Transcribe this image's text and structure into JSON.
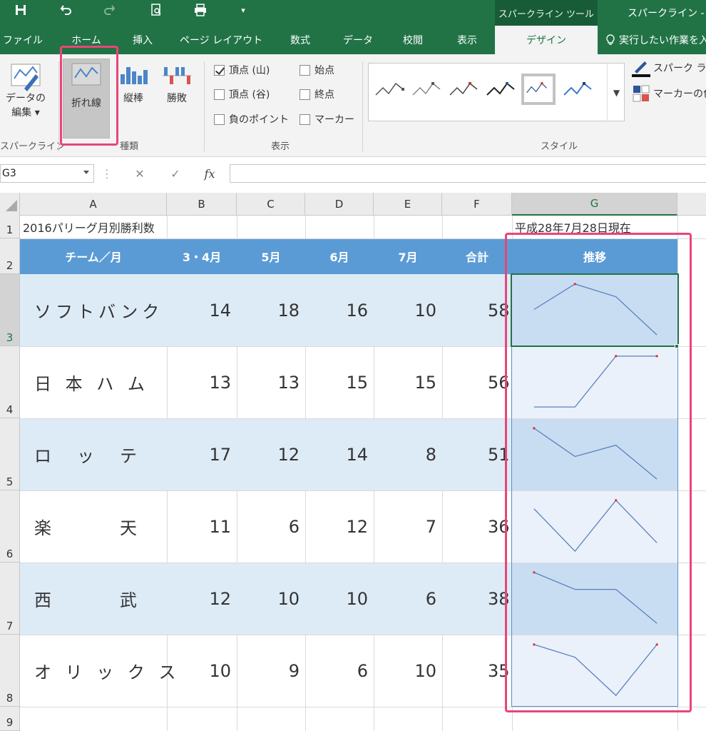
{
  "titlebar": {
    "context_tool": "スパークライン ツール",
    "window_title": "スパークライン -"
  },
  "tabs": [
    "ファイル",
    "ホーム",
    "挿入",
    "ページ レイアウト",
    "数式",
    "データ",
    "校閲",
    "表示",
    "デザイン"
  ],
  "active_tab": "デザイン",
  "tell_me": "実行したい作業を入",
  "ribbon": {
    "edit_data": [
      "データの",
      "編集 ▾"
    ],
    "group_sparkline": "スパークライン",
    "type_line": "折れ線",
    "type_column": "縦棒",
    "type_winloss": "勝敗",
    "group_type": "種類",
    "show": {
      "high_point": "頂点 (山)",
      "low_point": "頂点 (谷)",
      "negative_points": "負のポイント",
      "first_point": "始点",
      "last_point": "終点",
      "markers": "マーカー"
    },
    "group_show": "表示",
    "group_style": "スタイル",
    "sparkline_color": "スパーク ライ",
    "marker_color": "マーカーの色"
  },
  "formula_bar": {
    "name_box": "G3",
    "cancel": "✕",
    "enter": "✓",
    "fx": "fx"
  },
  "columns": [
    "A",
    "B",
    "C",
    "D",
    "E",
    "F",
    "G"
  ],
  "selected_column": "G",
  "rows": [
    "1",
    "2",
    "3",
    "4",
    "5",
    "6",
    "7",
    "8",
    "9"
  ],
  "sheet": {
    "title": "2016パリーグ月別勝利数",
    "as_of": "平成28年7月28日現在",
    "headers": [
      "チーム／月",
      "3・4月",
      "5月",
      "6月",
      "7月",
      "合計",
      "推移"
    ],
    "teams": [
      {
        "name": "ソフトバンク",
        "values": [
          14,
          18,
          16,
          10
        ],
        "total": "58"
      },
      {
        "name": "日 本 ハ ム",
        "values": [
          13,
          13,
          15,
          15
        ],
        "total": "56"
      },
      {
        "name": "ロ　ッ　テ",
        "values": [
          17,
          12,
          14,
          8
        ],
        "total": "51"
      },
      {
        "name": "楽　　　天",
        "values": [
          11,
          6,
          12,
          7
        ],
        "total": "36"
      },
      {
        "name": "西　　　武",
        "values": [
          12,
          10,
          10,
          6
        ],
        "total": "38"
      },
      {
        "name": "オ リ ッ ク ス",
        "values": [
          10,
          9,
          6,
          10
        ],
        "total": "35"
      }
    ]
  },
  "colors": {
    "excel_green": "#217346",
    "header_blue": "#5b9bd5",
    "band_blue": "#ddebf7",
    "sparkline": "#5b7fbf",
    "marker_red": "#e03030",
    "highlight_pink": "#e8457a"
  }
}
